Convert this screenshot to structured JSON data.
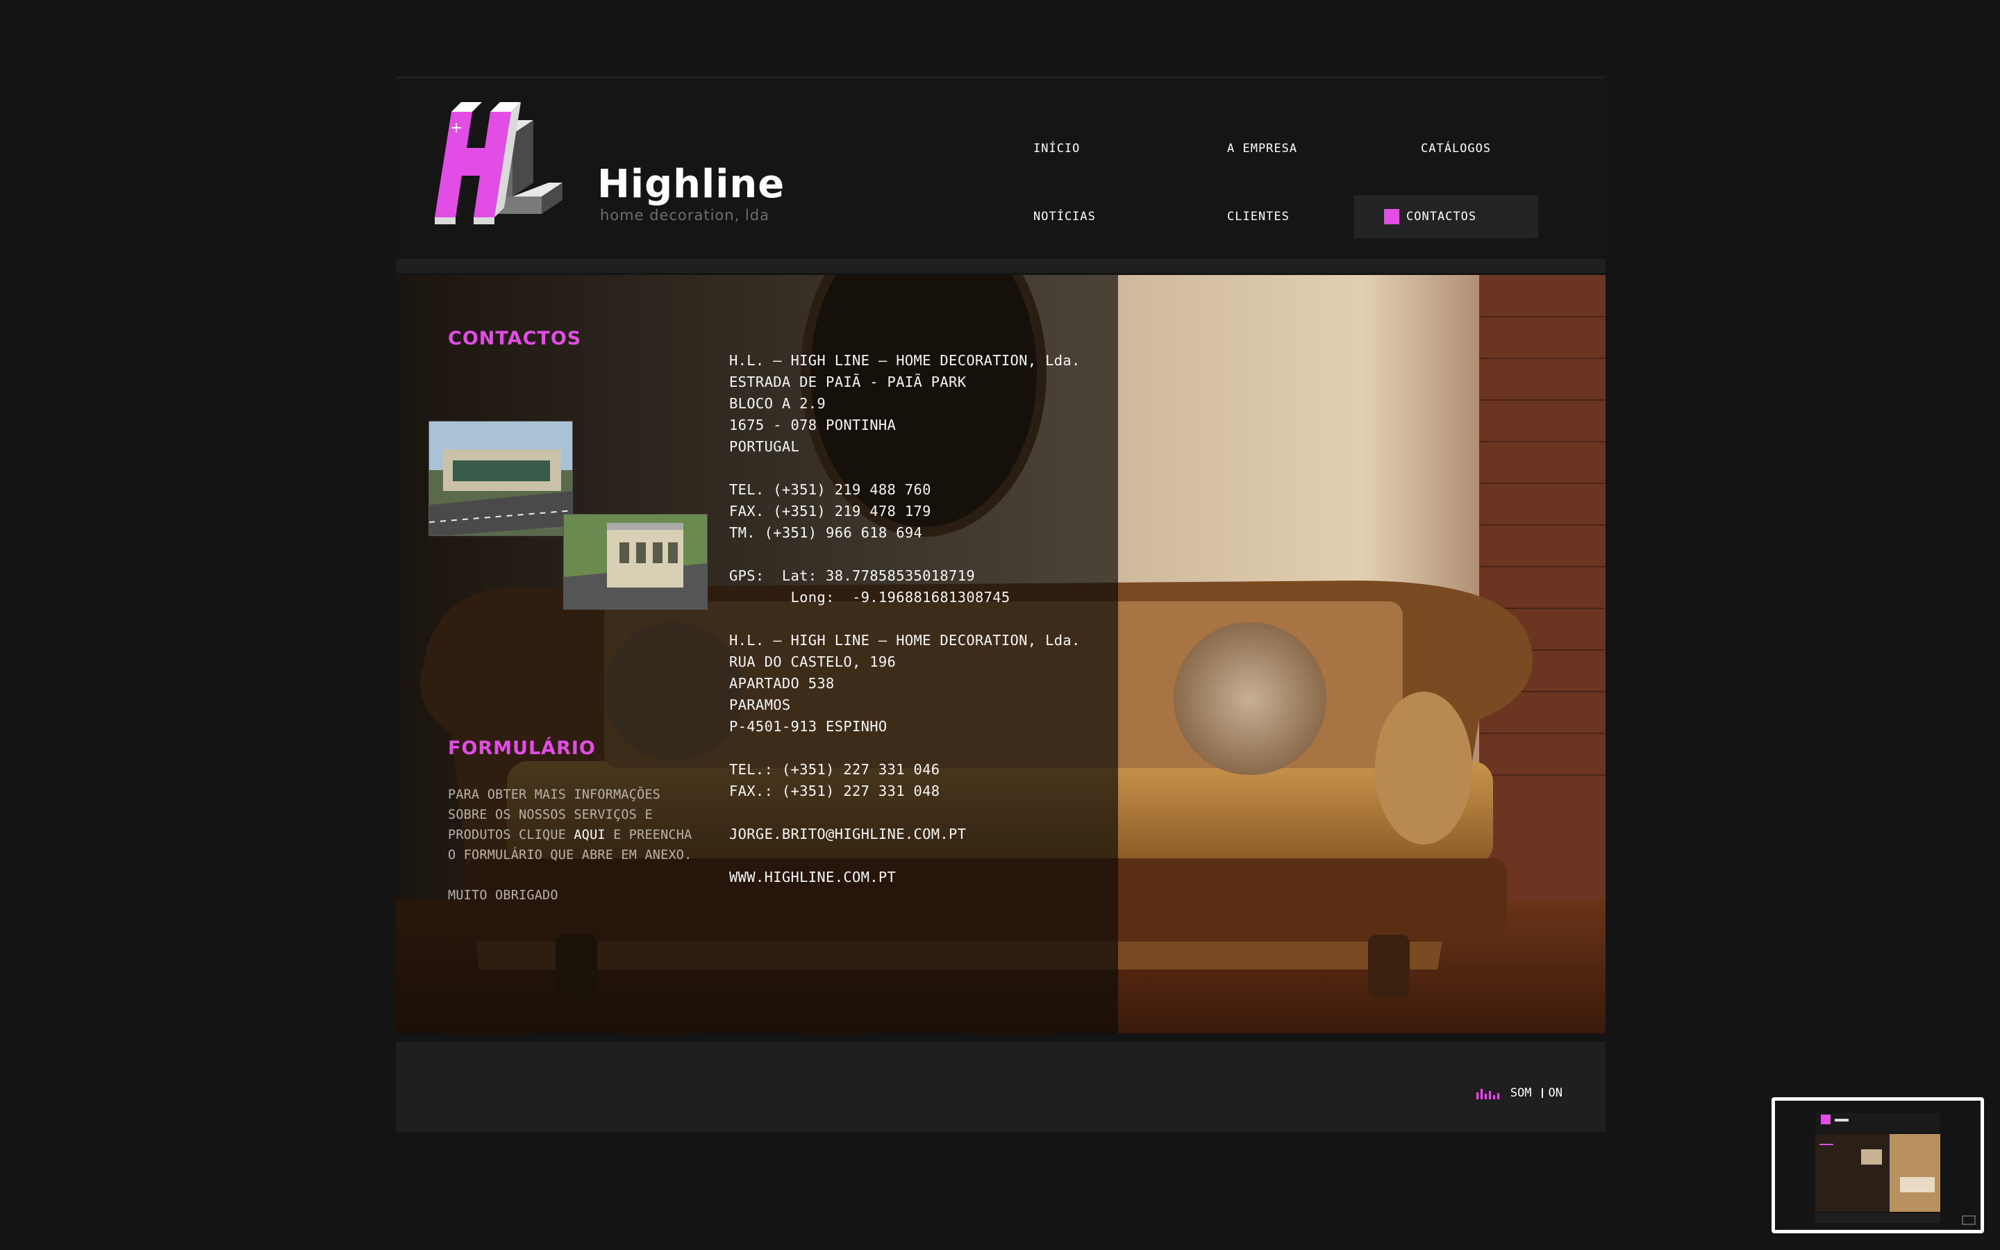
{
  "brand": {
    "name": "Highline",
    "tagline": "home decoration, lda",
    "logo_letters": "HL"
  },
  "colors": {
    "accent": "#e24ee5",
    "background": "#141414",
    "panel": "#1f1f1f"
  },
  "nav": {
    "items": [
      {
        "label": "INÍCIO"
      },
      {
        "label": "A EMPRESA"
      },
      {
        "label": "CATÁLOGOS"
      },
      {
        "label": "NOTÍCIAS"
      },
      {
        "label": "CLIENTES"
      },
      {
        "label": "CONTACTOS"
      }
    ],
    "active": "CONTACTOS"
  },
  "contactos": {
    "title": "CONTACTOS",
    "address1": [
      "H.L. – HIGH LINE – HOME DECORATION, Lda.",
      "ESTRADA DE PAIÃ - PAIÃ PARK",
      "BLOCO A 2.9",
      "1675 - 078 PONTINHA",
      "PORTUGAL"
    ],
    "phones1": [
      "TEL. (+351) 219 488 760",
      "FAX. (+351) 219 478 179",
      "TM. (+351) 966 618 694"
    ],
    "gps": [
      "GPS:  Lat: 38.77858535018719",
      "       Long:  -9.196881681308745"
    ],
    "address2": [
      "H.L. – HIGH LINE – HOME DECORATION, Lda.",
      "RUA DO CASTELO, 196",
      "APARTADO 538",
      "PARAMOS",
      "P-4501-913 ESPINHO"
    ],
    "phones2": [
      "TEL.: (+351) 227 331 046",
      "FAX.: (+351) 227 331 048"
    ],
    "email": "JORGE.BRITO@HIGHLINE.COM.PT",
    "website": "WWW.HIGHLINE.COM.PT"
  },
  "formulario": {
    "title": "FORMULÁRIO",
    "line1": "PARA OBTER MAIS INFORMAÇÕES",
    "line2": "SOBRE OS NOSSOS SERVIÇOS E",
    "line3_before": "PRODUTOS CLIQUE ",
    "link": "AQUI",
    "line3_after": " E PREENCHA",
    "line4": "O FORMULÁRIO QUE ABRE EM ANEXO.",
    "thanks": "MUITO OBRIGADO"
  },
  "footer": {
    "sound_label": "SOM",
    "sound_state": "ON"
  }
}
